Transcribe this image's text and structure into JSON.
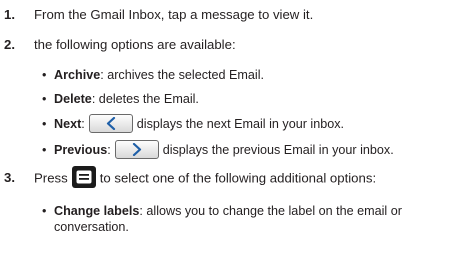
{
  "steps": [
    {
      "number": "1.",
      "text": "From the Gmail Inbox, tap a message to view it."
    },
    {
      "number": "2.",
      "text": "the following options are available:"
    },
    {
      "number": "3.",
      "text_before": "Press",
      "text_after": "to select one of the following additional options:"
    }
  ],
  "step2_bullets": [
    {
      "term": "Archive",
      "desc": ": archives the selected Email."
    },
    {
      "term": "Delete",
      "desc": ": deletes the Email."
    },
    {
      "term": "Next",
      "sep": ":",
      "desc": "displays the next Email in your inbox.",
      "icon": "chevron-left-icon"
    },
    {
      "term": "Previous",
      "sep": ":",
      "desc": "displays the previous Email in your inbox.",
      "icon": "chevron-right-icon"
    }
  ],
  "step3_bullets": [
    {
      "term": "Change labels",
      "desc_line1": ": allows you to change the label on the email or",
      "desc_line2": "conversation."
    }
  ],
  "bullet_char": "•",
  "icons": {
    "menu_key": "menu-key-icon"
  }
}
